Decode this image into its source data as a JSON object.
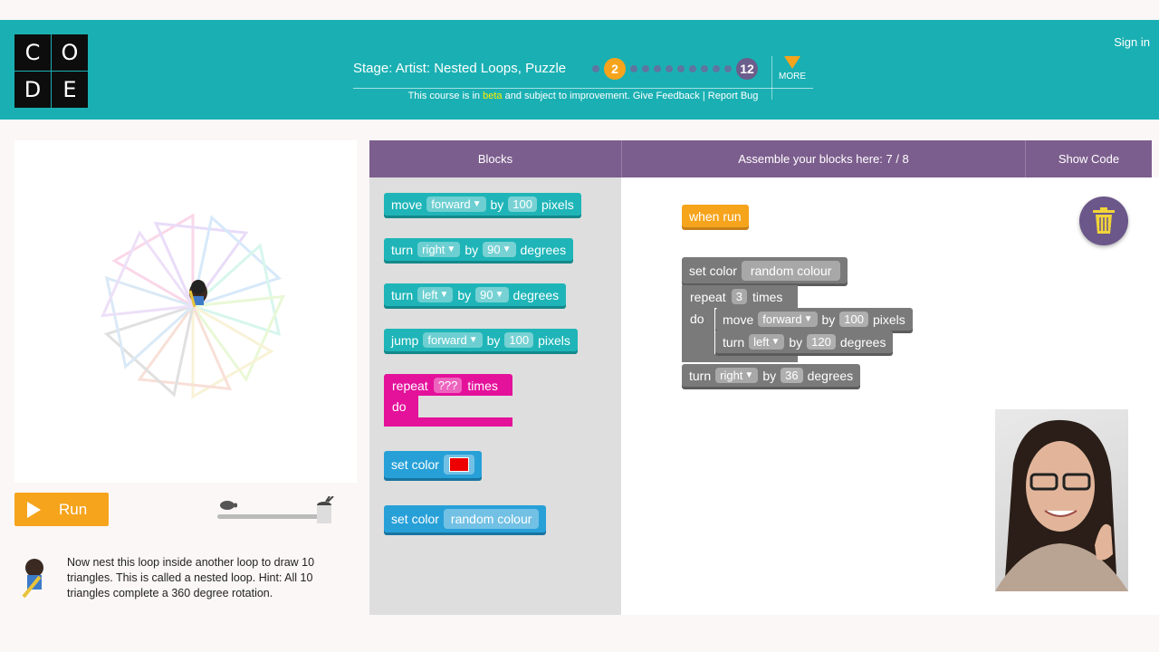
{
  "header": {
    "logo_letters": [
      "C",
      "O",
      "D",
      "E"
    ],
    "stage_title": "Stage: Artist: Nested Loops, Puzzle",
    "current_puzzle": "2",
    "last_puzzle": "12",
    "more_label": "MORE",
    "beta_prefix": "This course is in ",
    "beta_word": "beta",
    "beta_suffix": " and subject to improvement. Give Feedback | Report Bug",
    "sign_in": "Sign in"
  },
  "controls": {
    "run_label": "Run"
  },
  "instructions": "Now nest this loop inside another loop to draw 10 triangles. This is called a nested loop. Hint: All 10 triangles complete a 360 degree rotation.",
  "workspace_header": {
    "blocks": "Blocks",
    "assemble": "Assemble your blocks here: 7 / 8",
    "show_code": "Show Code"
  },
  "toolbox": {
    "move": {
      "verb": "move",
      "dir": "forward",
      "by": "by",
      "amount": "100",
      "unit": "pixels"
    },
    "turn_right": {
      "verb": "turn",
      "dir": "right",
      "by": "by",
      "amount": "90",
      "unit": "degrees"
    },
    "turn_left": {
      "verb": "turn",
      "dir": "left",
      "by": "by",
      "amount": "90",
      "unit": "degrees"
    },
    "jump": {
      "verb": "jump",
      "dir": "forward",
      "by": "by",
      "amount": "100",
      "unit": "pixels"
    },
    "repeat": {
      "verb": "repeat",
      "count": "???",
      "unit": "times",
      "do": "do"
    },
    "set_color": {
      "label": "set color"
    },
    "set_random": {
      "label": "set color",
      "value": "random colour"
    }
  },
  "program": {
    "when_run": "when run",
    "set_color": {
      "label": "set color",
      "value": "random colour"
    },
    "repeat": {
      "verb": "repeat",
      "count": "3",
      "unit": "times",
      "do": "do"
    },
    "inner_move": {
      "verb": "move",
      "dir": "forward",
      "by": "by",
      "amount": "100",
      "unit": "pixels"
    },
    "inner_turn": {
      "verb": "turn",
      "dir": "left",
      "by": "by",
      "amount": "120",
      "unit": "degrees"
    },
    "outer_turn": {
      "verb": "turn",
      "dir": "right",
      "by": "by",
      "amount": "36",
      "unit": "degrees"
    }
  },
  "colors": {
    "header_teal": "#1ab0b3",
    "accent_orange": "#f6a41c",
    "purple": "#7c5e8e",
    "block_teal": "#1fb5b8",
    "block_blue": "#27a0d8",
    "block_pink": "#e4119b",
    "block_gray": "#7a7a7a"
  },
  "icons": {
    "trash": "trash-icon",
    "turtle": "turtle-icon",
    "rabbit": "rabbit-icon",
    "play": "play-icon"
  }
}
